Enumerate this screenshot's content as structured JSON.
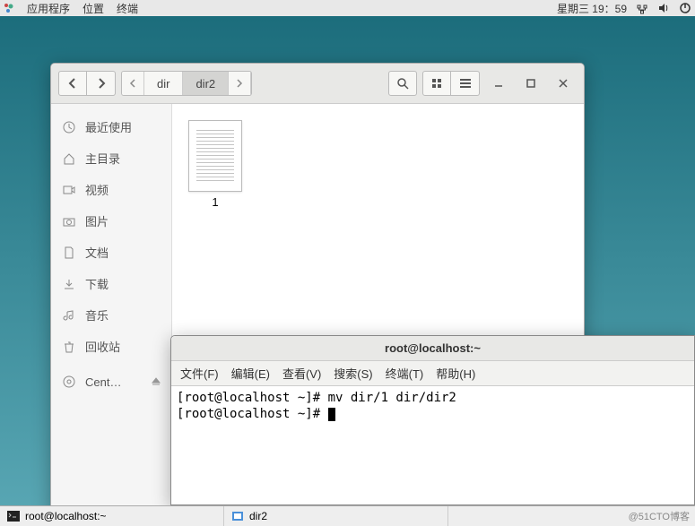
{
  "topbar": {
    "apps": "应用程序",
    "places": "位置",
    "terminal": "终端",
    "clock": "星期三 19：59"
  },
  "filemanager": {
    "path": {
      "dir": "dir",
      "dir2": "dir2"
    },
    "sidebar": {
      "recent": "最近使用",
      "home": "主目录",
      "videos": "视频",
      "pictures": "图片",
      "documents": "文档",
      "downloads": "下载",
      "music": "音乐",
      "trash": "回收站",
      "cent": "Cent…"
    },
    "file1": "1"
  },
  "terminal": {
    "title": "root@localhost:~",
    "menu": {
      "file": "文件(F)",
      "edit": "编辑(E)",
      "view": "查看(V)",
      "search": "搜索(S)",
      "terminal": "终端(T)",
      "help": "帮助(H)"
    },
    "line1": "[root@localhost ~]# mv dir/1 dir/dir2",
    "line2_prompt": "[root@localhost ~]# "
  },
  "taskbar": {
    "term": "root@localhost:~",
    "fm": "dir2",
    "watermark": "@51CTO博客"
  }
}
